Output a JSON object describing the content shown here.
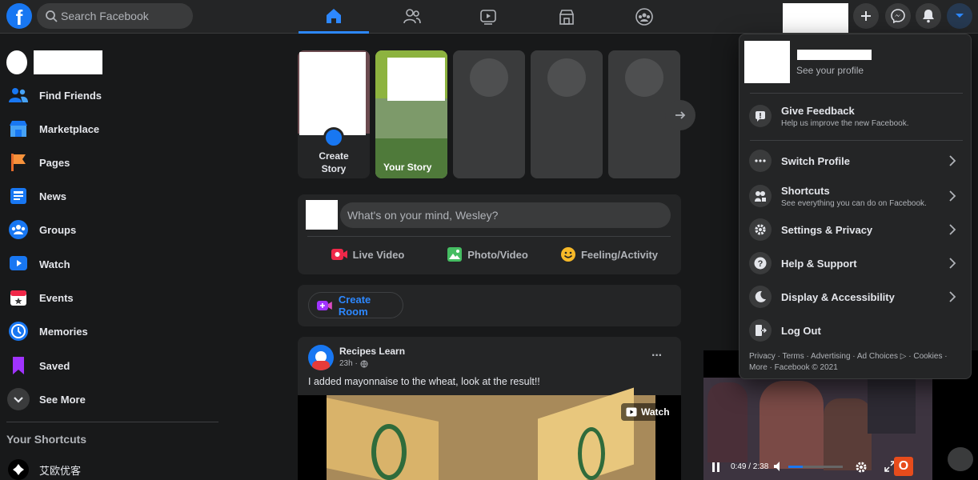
{
  "topbar": {
    "logo_letter": "f",
    "search_placeholder": "Search Facebook"
  },
  "sidebar": {
    "items": [
      {
        "label": "Find Friends",
        "icon": "friends-icon"
      },
      {
        "label": "Marketplace",
        "icon": "marketplace-icon"
      },
      {
        "label": "Pages",
        "icon": "pages-icon"
      },
      {
        "label": "News",
        "icon": "news-icon"
      },
      {
        "label": "Groups",
        "icon": "groups-icon"
      },
      {
        "label": "Watch",
        "icon": "watch-icon"
      },
      {
        "label": "Events",
        "icon": "events-icon"
      },
      {
        "label": "Memories",
        "icon": "memories-icon"
      },
      {
        "label": "Saved",
        "icon": "saved-icon"
      },
      {
        "label": "See More",
        "icon": "chevron-down-icon"
      }
    ],
    "shortcuts_heading": "Your Shortcuts",
    "shortcut_item": "艾欧优客"
  },
  "stories": {
    "create_label": "Create Story",
    "your_story_label": "Your Story"
  },
  "composer": {
    "placeholder": "What's on your mind, Wesley?",
    "live_video": "Live Video",
    "photo_video": "Photo/Video",
    "feeling_activity": "Feeling/Activity"
  },
  "room": {
    "create_room": "Create Room"
  },
  "post": {
    "author": "Recipes Learn",
    "time": "23h ·",
    "text": "I added mayonnaise to the wheat, look at the result!!",
    "watch_label": "Watch",
    "more": "···"
  },
  "video_player": {
    "time": "0:49 / 2:38"
  },
  "menu": {
    "see_profile": "See your profile",
    "give_feedback": "Give Feedback",
    "give_feedback_sub": "Help us improve the new Facebook.",
    "switch_profile": "Switch Profile",
    "shortcuts": "Shortcuts",
    "shortcuts_sub": "See everything you can do on Facebook.",
    "settings_privacy": "Settings & Privacy",
    "help_support": "Help & Support",
    "display_accessibility": "Display & Accessibility",
    "log_out": "Log Out",
    "footer_line1": "Privacy · Terms · Advertising · Ad Choices ▷ · Cookies ·",
    "footer_line2": "More · Facebook © 2021"
  },
  "colors": {
    "accent": "#2d88ff",
    "brand": "#1877f2",
    "background": "#18191a",
    "surface": "#242526"
  }
}
